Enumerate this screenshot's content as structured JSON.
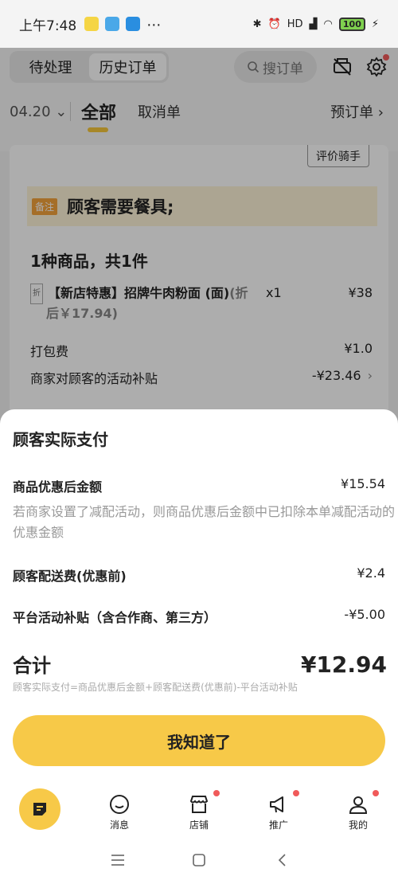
{
  "status_bar": {
    "time": "上午7:48",
    "network": "HD",
    "battery": "100"
  },
  "header": {
    "tabs": [
      "待处理",
      "历史订单"
    ],
    "search_placeholder": "搜订单"
  },
  "filter": {
    "date": "04.20",
    "all": "全部",
    "cancelled": "取消单",
    "preorder": "预订单"
  },
  "order": {
    "rate_rider": "评价骑手",
    "note_tag": "备注",
    "note_text": "顾客需要餐具;",
    "count": "1种商品，共1件",
    "item_tag": "折",
    "item_name": "【新店特惠】招牌牛肉粉面 (面)",
    "item_disc_a": "(折",
    "item_disc_b": "后￥17.94)",
    "item_qty": "x1",
    "item_price": "¥38",
    "packing_label": "打包费",
    "packing_value": "¥1.0",
    "subsidy_label": "商家对顾客的活动补贴",
    "subsidy_value": "-¥23.46"
  },
  "sheet": {
    "title": "顾客实际支付",
    "rows": [
      {
        "label": "商品优惠后金额",
        "value": "¥15.54"
      },
      {
        "label": "顾客配送费(优惠前)",
        "value": "¥2.4"
      },
      {
        "label": "平台活动补贴（含合作商、第三方）",
        "value": "-¥5.00"
      }
    ],
    "desc": "若商家设置了减配活动，则商品优惠后金额中已扣除本单减配活动的优惠金额",
    "total_label": "合计",
    "total_value": "¥12.94",
    "formula": "顾客实际支付=商品优惠后金额+顾客配送费(优惠前)-平台活动补贴",
    "confirm": "我知道了"
  },
  "tabbar": {
    "items": [
      "消息",
      "店铺",
      "推广",
      "我的"
    ]
  },
  "colors": {
    "accent": "#f7c948",
    "note_bg": "#fef4d8",
    "badge": "#f05a5a"
  }
}
